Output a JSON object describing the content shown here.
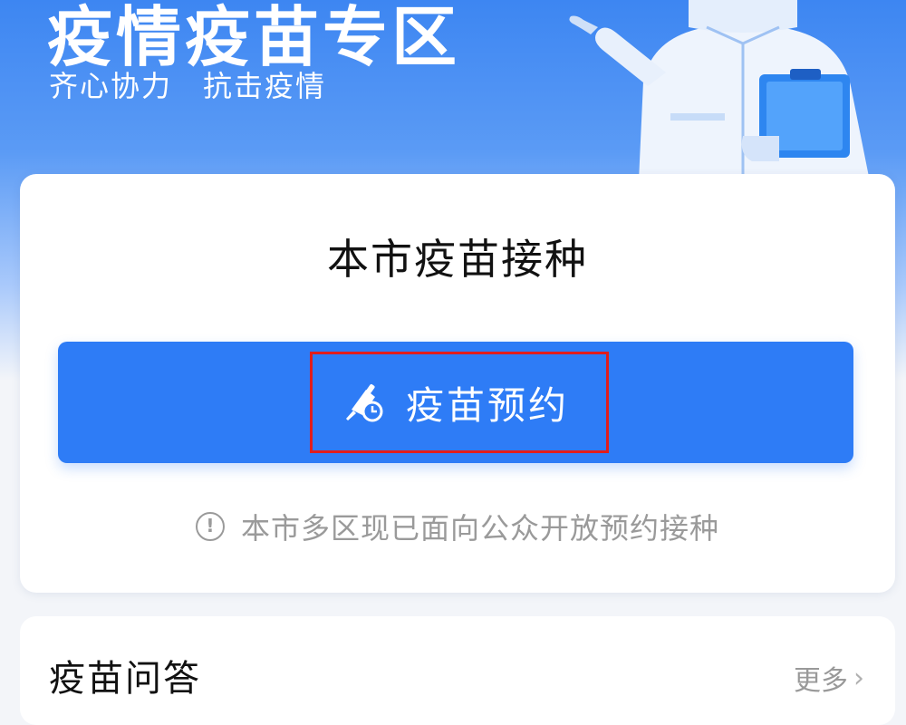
{
  "hero": {
    "title": "疫情疫苗专区",
    "subtitle": "齐心协力　抗击疫情"
  },
  "vaccination_card": {
    "title": "本市疫苗接种",
    "booking_button_label": "疫苗预约",
    "booking_icon": "syringe-clock-icon",
    "notice_icon": "info-circle-icon",
    "notice_text": "本市多区现已面向公众开放预约接种"
  },
  "qa_card": {
    "title": "疫苗问答",
    "more_label": "更多",
    "more_icon": "chevron-right-icon"
  },
  "colors": {
    "primary": "#2e7cf6",
    "hero_top": "#3d86f2",
    "highlight": "#e11d1d",
    "muted_text": "#9a9a9a"
  }
}
